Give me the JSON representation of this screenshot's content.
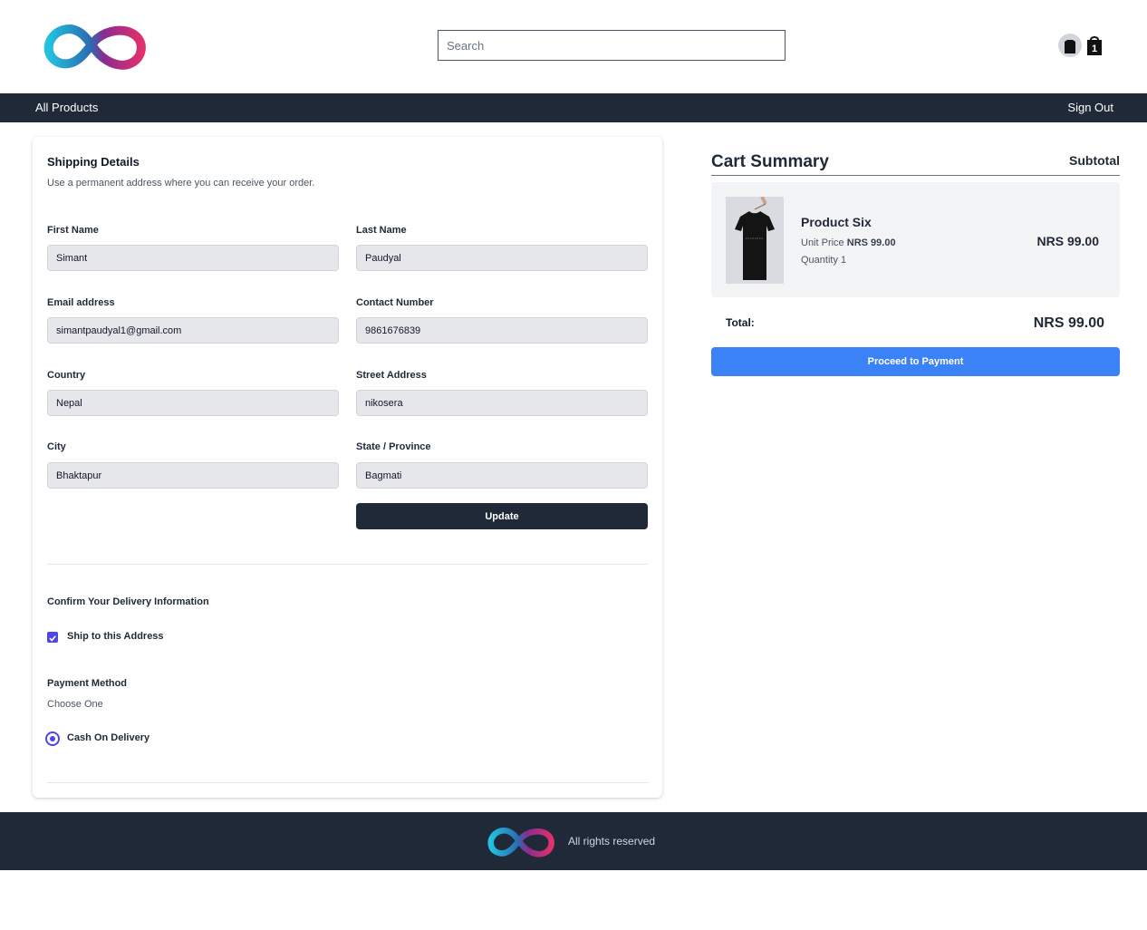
{
  "header": {
    "search_placeholder": "Search",
    "cart_count": "1"
  },
  "nav": {
    "all_products": "All Products",
    "sign_out": "Sign Out"
  },
  "shipping": {
    "title": "Shipping Details",
    "subtitle": "Use a permanent address where you can receive your order.",
    "fields": {
      "first_name": {
        "label": "First Name",
        "value": "Simant"
      },
      "last_name": {
        "label": "Last Name",
        "value": "Paudyal"
      },
      "email": {
        "label": "Email address",
        "value": "simantpaudyal1@gmail.com"
      },
      "contact": {
        "label": "Contact Number",
        "value": "9861676839"
      },
      "country": {
        "label": "Country",
        "value": "Nepal"
      },
      "street": {
        "label": "Street Address",
        "value": "nikosera"
      },
      "city": {
        "label": "City",
        "value": "Bhaktapur"
      },
      "state": {
        "label": "State / Province",
        "value": "Bagmati"
      }
    },
    "update_label": "Update",
    "confirm_title": "Confirm Your Delivery Information",
    "ship_to_address": "Ship to this Address",
    "payment_title": "Payment Method",
    "payment_sub": "Choose One",
    "cash_on_delivery": "Cash On Delivery"
  },
  "cart": {
    "title": "Cart Summary",
    "subtotal_label": "Subtotal",
    "item": {
      "name": "Product Six",
      "unit_price_label": "Unit Price",
      "unit_price": "NRS 99.00",
      "quantity": "Quantity 1",
      "price": "NRS 99.00"
    },
    "total_label": "Total:",
    "total_value": "NRS 99.00",
    "pay_label": "Proceed to Payment"
  },
  "footer": {
    "text": "All rights reserved"
  },
  "colors": {
    "nav_bg": "#1f2937",
    "accent": "#4f46e5",
    "pay_button": "#3b82f6"
  }
}
